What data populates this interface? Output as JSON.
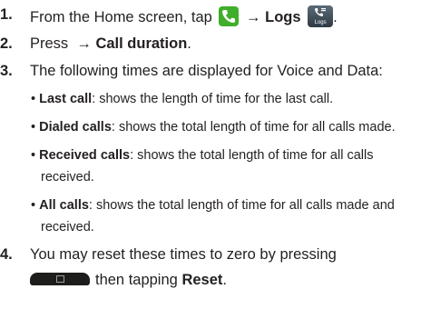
{
  "steps": [
    {
      "number": "1.",
      "prefix": "From the Home screen, tap",
      "arrow": "→",
      "bold": "Logs",
      "icons": [
        "phone-icon",
        "logs-icon"
      ],
      "logs_icon_label": "Logs",
      "suffix": "."
    },
    {
      "number": "2.",
      "prefix": "Press",
      "arrow": "→",
      "bold": "Call duration",
      "suffix": "."
    },
    {
      "number": "3.",
      "text": "The following times are displayed for Voice and Data:",
      "bullets": [
        {
          "bullet": "•",
          "bold": "Last call",
          "text": ": shows the length of time for the last call."
        },
        {
          "bullet": "•",
          "bold": "Dialed calls",
          "text": ": shows the total length of time for all calls made."
        },
        {
          "bullet": "•",
          "bold": "Received calls",
          "text": ": shows the total length of time for all calls",
          "continuation": "received."
        },
        {
          "bullet": "•",
          "bold": "All calls",
          "text": ": shows the total length of time for all calls made and",
          "continuation": "received."
        }
      ]
    },
    {
      "number": "4.",
      "text": "You may reset these times to zero by pressing",
      "line2_middle": "then tapping",
      "bold": "Reset",
      "suffix": ".",
      "icon": "menu-key-icon"
    }
  ],
  "colors": {
    "text": "#231f20",
    "phone_icon": "#3fae2a",
    "logs_icon": "#3a4854",
    "menu_key": "#1d1d1b"
  }
}
